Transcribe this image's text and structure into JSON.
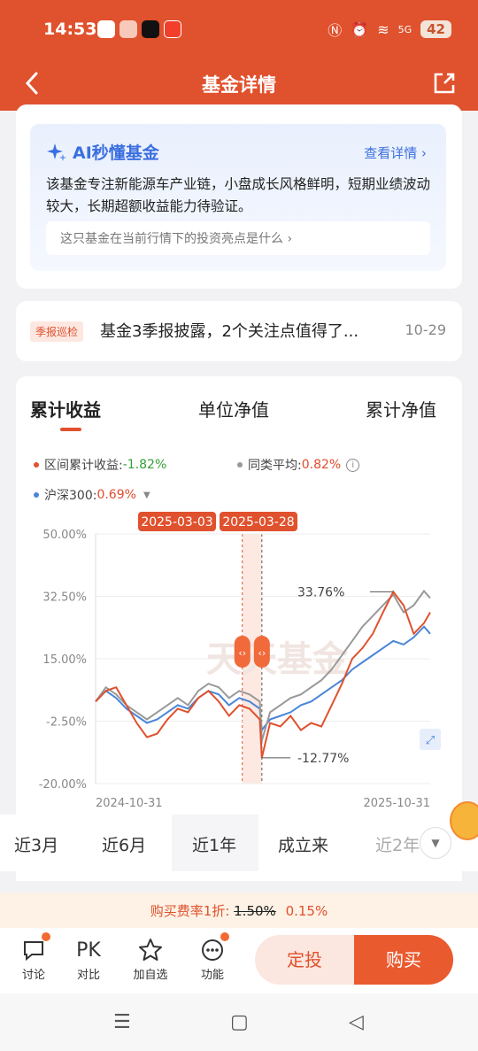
{
  "status": {
    "time": "14:53",
    "battery": "42",
    "network": "5G"
  },
  "nav": {
    "title": "基金详情"
  },
  "ai": {
    "title": "AI秒懂基金",
    "link": "查看详情",
    "summary": "该基金专注新能源车产业链，小盘成长风格鲜明，短期业绩波动较大，长期超额收益能力待验证。",
    "question": "这只基金在当前行情下的投资亮点是什么"
  },
  "news": {
    "tag": "季报巡检",
    "title": "基金3季报披露，2个关注点值得了...",
    "date": "10-29"
  },
  "chart_tabs": [
    "累计收益",
    "单位净值",
    "累计净值"
  ],
  "legend": {
    "fund_label": "区间累计收益:",
    "fund_value": "-1.82%",
    "peer_label": "同类平均:",
    "peer_value": "0.82%",
    "index_label": "沪深300:",
    "index_value": "0.69%"
  },
  "chart_data": {
    "type": "line",
    "x_range": [
      "2024-10-31",
      "2025-10-31"
    ],
    "yticks": [
      "50.00%",
      "32.50%",
      "15.00%",
      "-2.50%",
      "-20.00%"
    ],
    "ylim": [
      -20,
      50
    ],
    "highlight": {
      "start": "2025-03-03",
      "end": "2025-03-28"
    },
    "annotations": [
      {
        "text": "33.76%",
        "value": 33.76
      },
      {
        "text": "-12.77%",
        "value": -12.77
      }
    ],
    "watermark": "天天基金",
    "series": [
      {
        "name": "区间累计收益",
        "color": "#e0512d",
        "values": [
          [
            0,
            3
          ],
          [
            1,
            6
          ],
          [
            2,
            7
          ],
          [
            3,
            2
          ],
          [
            4,
            -3
          ],
          [
            5,
            -7
          ],
          [
            6,
            -6
          ],
          [
            7,
            -2
          ],
          [
            8,
            1
          ],
          [
            9,
            0
          ],
          [
            10,
            4
          ],
          [
            11,
            6
          ],
          [
            12,
            3
          ],
          [
            13,
            -1
          ],
          [
            14,
            2
          ],
          [
            15,
            1
          ],
          [
            16,
            -2
          ],
          [
            16.2,
            -12.77
          ],
          [
            17,
            -3
          ],
          [
            18,
            -4
          ],
          [
            19,
            -1
          ],
          [
            20,
            -5
          ],
          [
            21,
            -3
          ],
          [
            22,
            -4
          ],
          [
            23,
            2
          ],
          [
            24,
            8
          ],
          [
            25,
            15
          ],
          [
            26,
            18
          ],
          [
            27,
            22
          ],
          [
            28,
            28
          ],
          [
            29,
            33.76
          ],
          [
            30,
            30
          ],
          [
            31,
            22
          ],
          [
            32,
            25
          ],
          [
            32.6,
            28
          ]
        ]
      },
      {
        "name": "同类平均",
        "color": "#999999",
        "values": [
          [
            0,
            3
          ],
          [
            1,
            7
          ],
          [
            2,
            5
          ],
          [
            3,
            2
          ],
          [
            4,
            0
          ],
          [
            5,
            -2
          ],
          [
            6,
            0
          ],
          [
            7,
            2
          ],
          [
            8,
            4
          ],
          [
            9,
            2
          ],
          [
            10,
            6
          ],
          [
            11,
            8
          ],
          [
            12,
            7
          ],
          [
            13,
            4
          ],
          [
            14,
            6
          ],
          [
            15,
            5
          ],
          [
            16,
            3
          ],
          [
            16.2,
            -8
          ],
          [
            17,
            0
          ],
          [
            18,
            2
          ],
          [
            19,
            4
          ],
          [
            20,
            5
          ],
          [
            21,
            7
          ],
          [
            22,
            9
          ],
          [
            23,
            12
          ],
          [
            24,
            16
          ],
          [
            25,
            20
          ],
          [
            26,
            24
          ],
          [
            27,
            27
          ],
          [
            28,
            30
          ],
          [
            29,
            33
          ],
          [
            30,
            28
          ],
          [
            31,
            30
          ],
          [
            32,
            34
          ],
          [
            32.6,
            32
          ]
        ]
      },
      {
        "name": "沪深300",
        "color": "#4a86d8",
        "values": [
          [
            0,
            3
          ],
          [
            1,
            6
          ],
          [
            2,
            4
          ],
          [
            3,
            1
          ],
          [
            4,
            -1
          ],
          [
            5,
            -3
          ],
          [
            6,
            -2
          ],
          [
            7,
            0
          ],
          [
            8,
            2
          ],
          [
            9,
            1
          ],
          [
            10,
            4
          ],
          [
            11,
            6
          ],
          [
            12,
            5
          ],
          [
            13,
            2
          ],
          [
            14,
            4
          ],
          [
            15,
            3
          ],
          [
            16,
            1
          ],
          [
            16.2,
            -5
          ],
          [
            17,
            -2
          ],
          [
            18,
            -1
          ],
          [
            19,
            0
          ],
          [
            20,
            2
          ],
          [
            21,
            3
          ],
          [
            22,
            5
          ],
          [
            23,
            7
          ],
          [
            24,
            9
          ],
          [
            25,
            12
          ],
          [
            26,
            14
          ],
          [
            27,
            16
          ],
          [
            28,
            18
          ],
          [
            29,
            20
          ],
          [
            30,
            19
          ],
          [
            31,
            21
          ],
          [
            32,
            24
          ],
          [
            32.6,
            22
          ]
        ]
      }
    ]
  },
  "periods": [
    "近3月",
    "近6月",
    "近1年",
    "成立来",
    "近2年"
  ],
  "fee": {
    "label": "购买费率1折:",
    "original": "1.50%",
    "current": "0.15%"
  },
  "toolbar": {
    "discuss": "讨论",
    "pk_glyph": "PK",
    "compare": "对比",
    "favorite": "加自选",
    "functions": "功能"
  },
  "actions": {
    "fixed": "定投",
    "buy": "购买"
  }
}
